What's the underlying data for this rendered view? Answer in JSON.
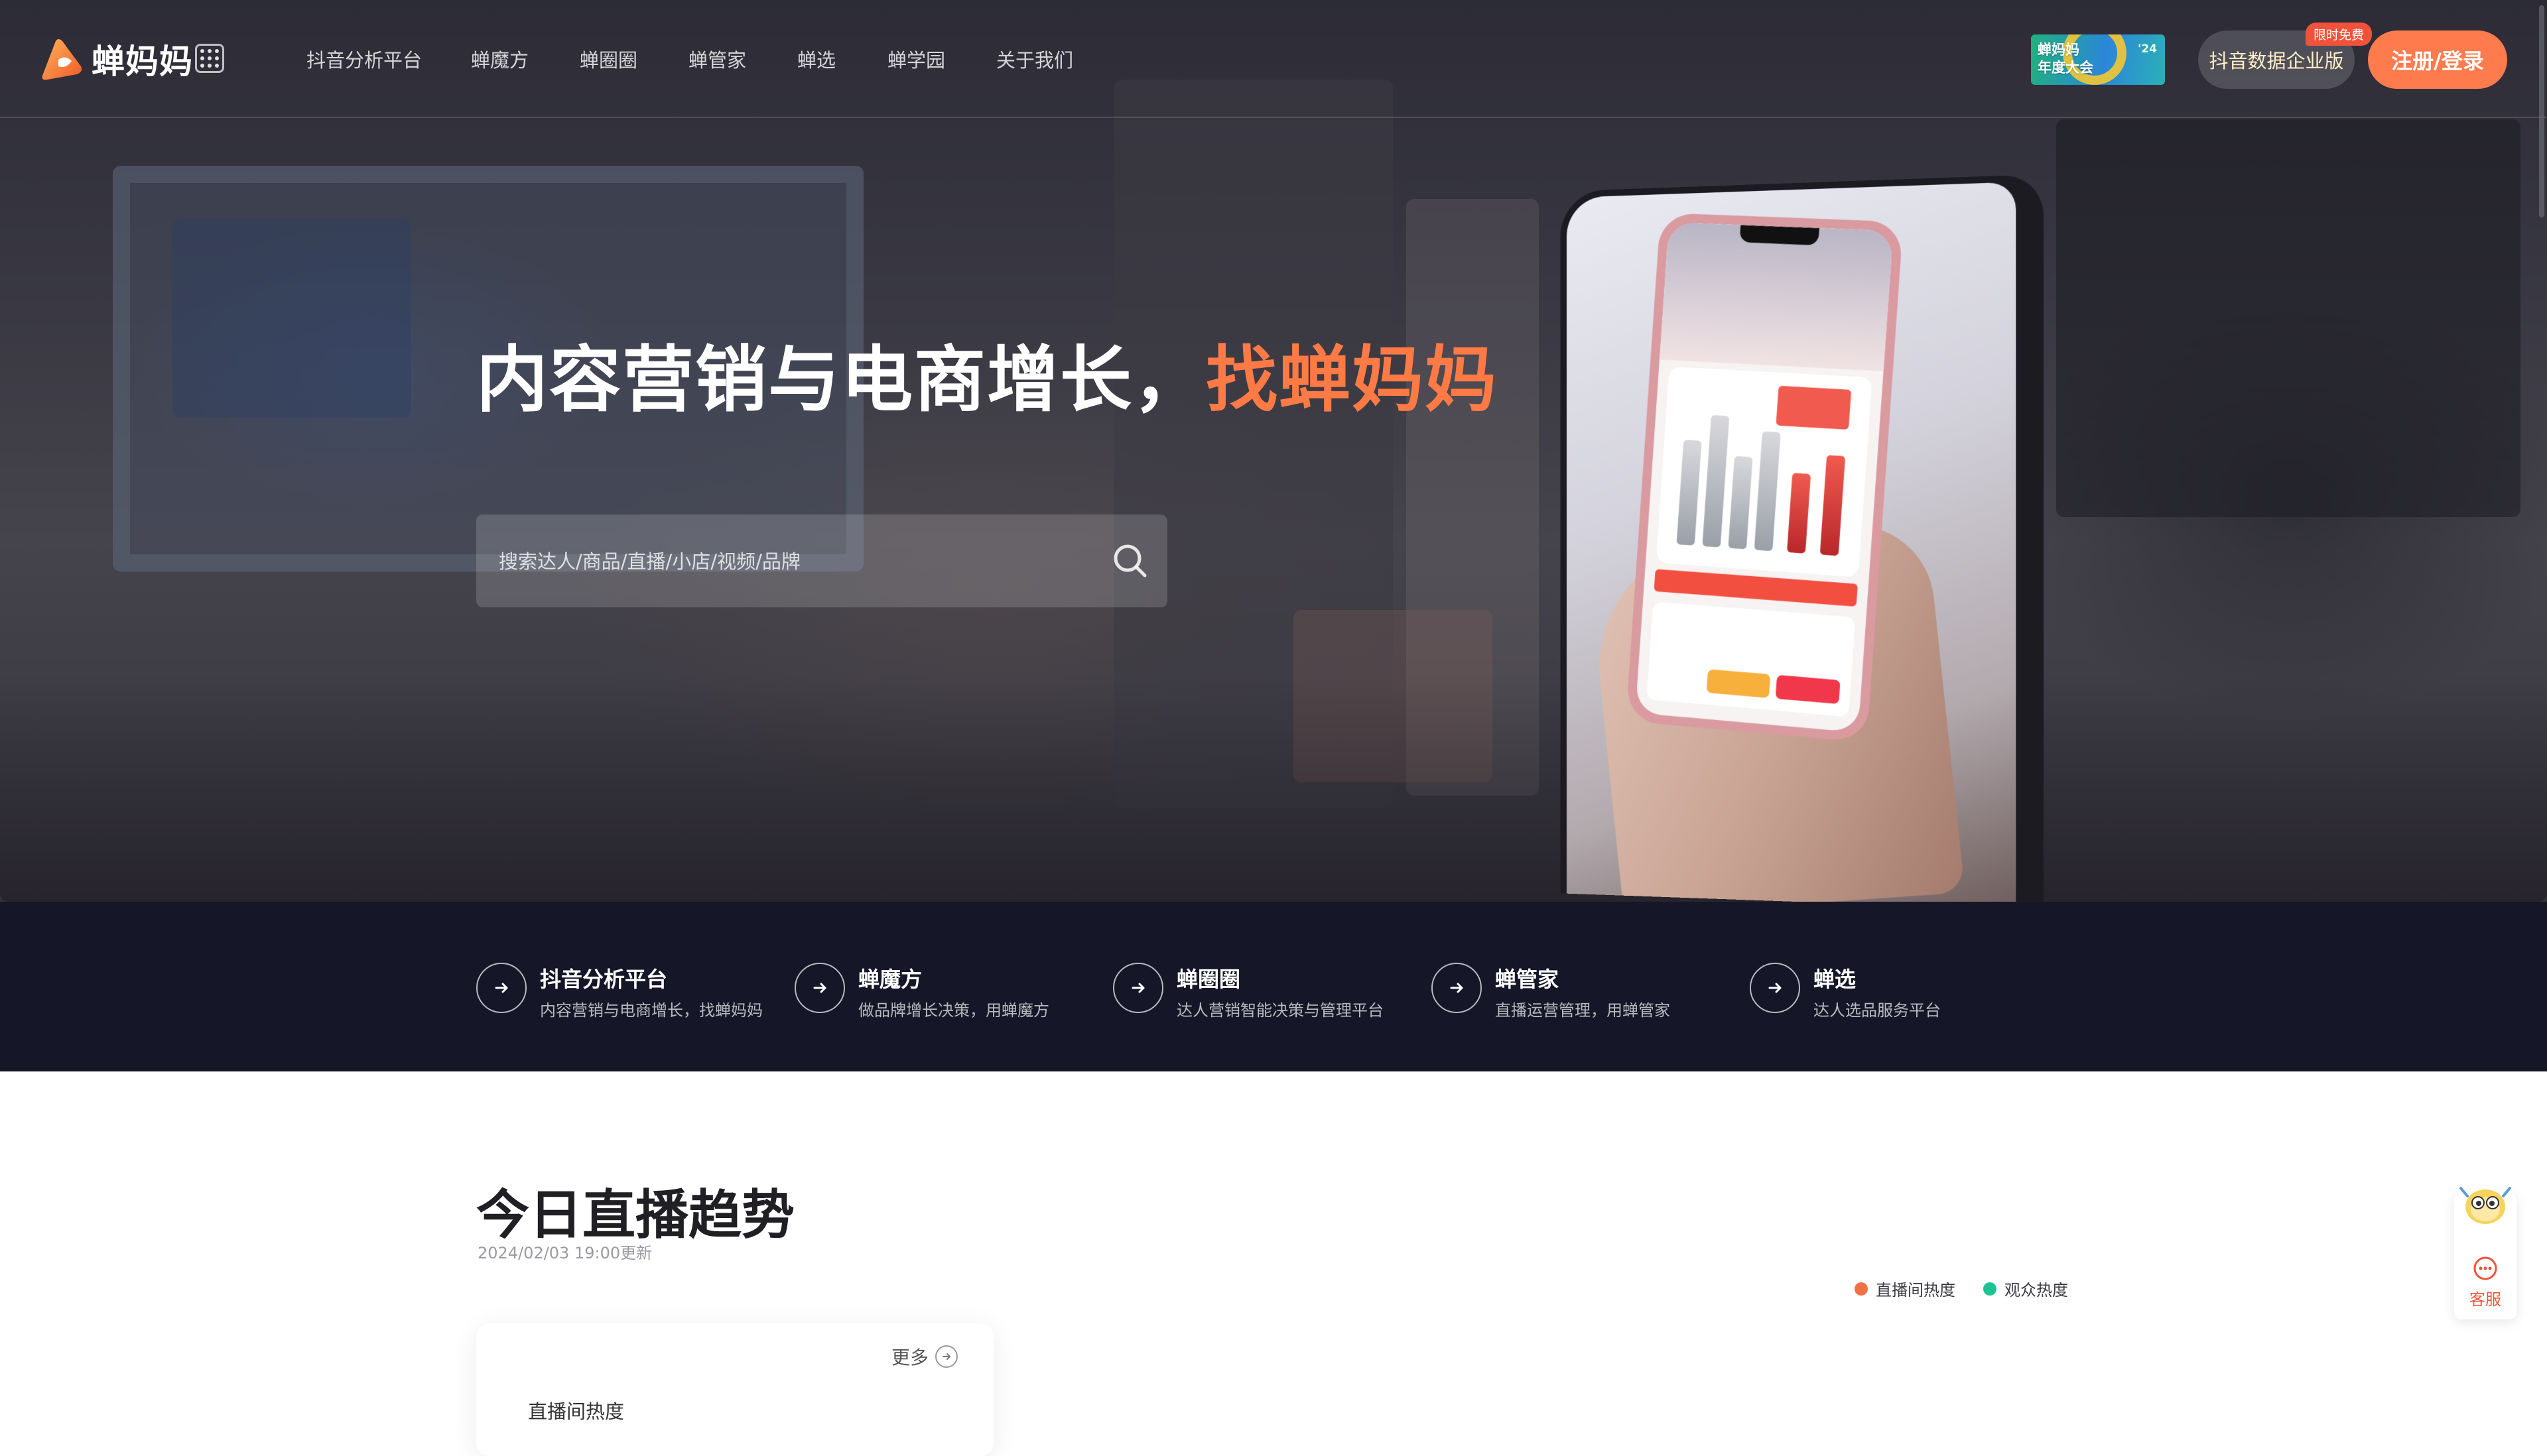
{
  "brand": {
    "name": "蝉妈妈"
  },
  "nav": [
    {
      "label": "抖音分析平台"
    },
    {
      "label": "蝉魔方"
    },
    {
      "label": "蝉圈圈"
    },
    {
      "label": "蝉管家"
    },
    {
      "label": "蝉选"
    },
    {
      "label": "蝉学园"
    },
    {
      "label": "关于我们"
    }
  ],
  "header": {
    "promo_line1": "蝉妈妈",
    "promo_line2": "年度大会",
    "promo_year": "'24",
    "enterprise_label": "抖音数据企业版",
    "free_tag": "限时免费",
    "login_label": "注册/登录"
  },
  "hero": {
    "title_main": "内容营销与电商增长，",
    "title_accent": "找蝉妈妈",
    "search_placeholder": "搜索达人/商品/直播/小店/视频/品牌"
  },
  "products": [
    {
      "title": "抖音分析平台",
      "desc": "内容营销与电商增长，找蝉妈妈"
    },
    {
      "title": "蝉魔方",
      "desc": "做品牌增长决策，用蝉魔方"
    },
    {
      "title": "蝉圈圈",
      "desc": "达人营销智能决策与管理平台"
    },
    {
      "title": "蝉管家",
      "desc": "直播运营管理，用蝉管家"
    },
    {
      "title": "蝉选",
      "desc": "达人选品服务平台"
    }
  ],
  "trend": {
    "title": "今日直播趋势",
    "updated": "2024/02/03 19:00更新",
    "legend": [
      {
        "label": "直播间热度",
        "color": "#f07148"
      },
      {
        "label": "观众热度",
        "color": "#1bc492"
      }
    ],
    "more_label": "更多",
    "card_label": "直播间热度"
  },
  "service": {
    "label": "客服"
  },
  "colors": {
    "accent": "#ff7a45",
    "login": "#fe7b4e",
    "strip": "#151627"
  }
}
